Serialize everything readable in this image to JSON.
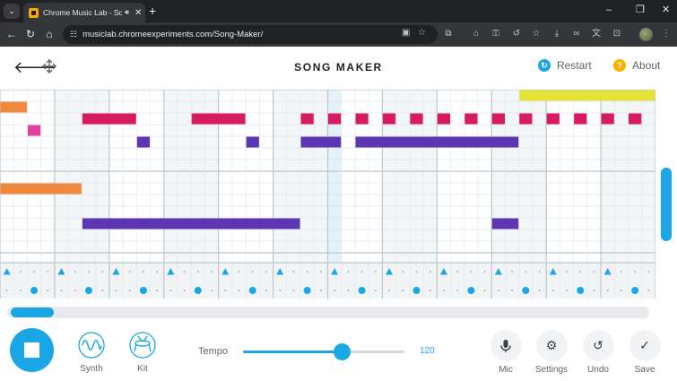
{
  "browser": {
    "tab_title": "Chrome Music Lab - Song M",
    "tab_audio_icon": "speaker-icon",
    "new_tab": "+",
    "url": "musiclab.chromeexperiments.com/Song-Maker/",
    "window_controls": [
      "–",
      "❐",
      "✕"
    ]
  },
  "header": {
    "title": "SONG MAKER",
    "restart_label": "Restart",
    "about_label": "About",
    "about_glyph": "?"
  },
  "colors": {
    "accent": "#1ba7e6",
    "melody_red": "#d81b60",
    "melody_purple": "#5e35b1",
    "melody_orange": "#f0883e",
    "melody_pink": "#e040a0",
    "melody_yellow": "#e4e337",
    "restart": "#1ba7e6",
    "about": "#f4b400"
  },
  "grid": {
    "columns": 48,
    "melody_rows": 16,
    "highlight_column": 24,
    "notes": [
      {
        "row": 0,
        "start": 38,
        "len": 12,
        "color": "melody_yellow"
      },
      {
        "row": 1,
        "start": 0,
        "len": 2,
        "color": "melody_orange"
      },
      {
        "row": 2,
        "start": 6,
        "len": 4,
        "color": "melody_red"
      },
      {
        "row": 2,
        "start": 14,
        "len": 4,
        "color": "melody_red"
      },
      {
        "row": 2,
        "start": 22,
        "len": 1,
        "color": "melody_red"
      },
      {
        "row": 2,
        "start": 24,
        "len": 1,
        "color": "melody_red"
      },
      {
        "row": 2,
        "start": 26,
        "len": 1,
        "color": "melody_red"
      },
      {
        "row": 2,
        "start": 28,
        "len": 1,
        "color": "melody_red"
      },
      {
        "row": 2,
        "start": 30,
        "len": 1,
        "color": "melody_red"
      },
      {
        "row": 2,
        "start": 32,
        "len": 1,
        "color": "melody_red"
      },
      {
        "row": 2,
        "start": 34,
        "len": 1,
        "color": "melody_red"
      },
      {
        "row": 2,
        "start": 36,
        "len": 1,
        "color": "melody_red"
      },
      {
        "row": 2,
        "start": 38,
        "len": 1,
        "color": "melody_red"
      },
      {
        "row": 2,
        "start": 40,
        "len": 1,
        "color": "melody_red"
      },
      {
        "row": 2,
        "start": 42,
        "len": 1,
        "color": "melody_red"
      },
      {
        "row": 2,
        "start": 44,
        "len": 1,
        "color": "melody_red"
      },
      {
        "row": 2,
        "start": 46,
        "len": 1,
        "color": "melody_red"
      },
      {
        "row": 3,
        "start": 2,
        "len": 1,
        "color": "melody_pink"
      },
      {
        "row": 4,
        "start": 10,
        "len": 1,
        "color": "melody_purple"
      },
      {
        "row": 4,
        "start": 18,
        "len": 1,
        "color": "melody_purple"
      },
      {
        "row": 4,
        "start": 22,
        "len": 3,
        "color": "melody_purple"
      },
      {
        "row": 4,
        "start": 26,
        "len": 12,
        "color": "melody_purple"
      },
      {
        "row": 8,
        "start": 0,
        "len": 6,
        "color": "melody_orange"
      },
      {
        "row": 11,
        "start": 6,
        "len": 16,
        "color": "melody_purple"
      },
      {
        "row": 11,
        "start": 36,
        "len": 2,
        "color": "melody_purple"
      }
    ],
    "rhythm_triangles": [
      0,
      4,
      8,
      12,
      16,
      20,
      24,
      28,
      32,
      36,
      40,
      44,
      48
    ],
    "rhythm_circles": [
      2,
      6,
      10,
      14,
      18,
      22,
      26,
      30,
      34,
      38,
      42,
      46
    ]
  },
  "scroll": {
    "horizontal_fraction": 0.07,
    "vertical_fraction": 0.45
  },
  "controls": {
    "play_state": "stop-icon",
    "synth_label": "Synth",
    "kit_label": "Kit",
    "tempo_label": "Tempo",
    "tempo_value": "120",
    "tempo_fraction": 0.61,
    "mic_label": "Mic",
    "settings_label": "Settings",
    "undo_label": "Undo",
    "save_label": "Save"
  }
}
